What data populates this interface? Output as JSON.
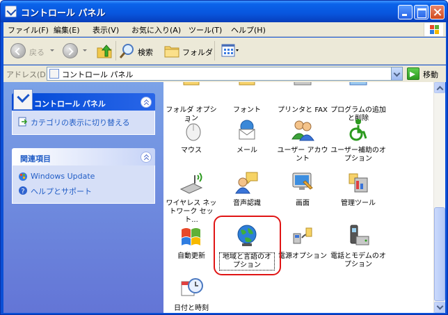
{
  "window": {
    "title": "コントロール パネル"
  },
  "menu": {
    "items": [
      "ファイル(F)",
      "編集(E)",
      "表示(V)",
      "お気に入り(A)",
      "ツール(T)",
      "ヘルプ(H)"
    ]
  },
  "toolbar": {
    "back_label": "戻る",
    "search_label": "検索",
    "folders_label": "フォルダ"
  },
  "address": {
    "label": "アドレス(D)",
    "value": "コントロール パネル",
    "go_label": "移動"
  },
  "taskpane": {
    "main_panel": {
      "title": "コントロール パネル",
      "links": [
        "カテゴリの表示に切り替える"
      ]
    },
    "related_panel": {
      "title": "関連項目",
      "links": [
        "Windows Update",
        "ヘルプとサポート"
      ]
    }
  },
  "items": {
    "row0": [
      "フォルダ オプション",
      "フォント",
      "プリンタと FAX",
      "プログラムの追加と削除"
    ],
    "row1": [
      "マウス",
      "メール",
      "ユーザー アカウント",
      "ユーザー補助のオプション"
    ],
    "row2": [
      "ワイヤレス ネットワーク セット...",
      "音声認識",
      "画面",
      "管理ツール"
    ],
    "row3": [
      "自動更新",
      "地域と言語のオプション",
      "電源オプション",
      "電話とモデムのオプション"
    ],
    "row4": [
      "日付と時刻"
    ]
  }
}
